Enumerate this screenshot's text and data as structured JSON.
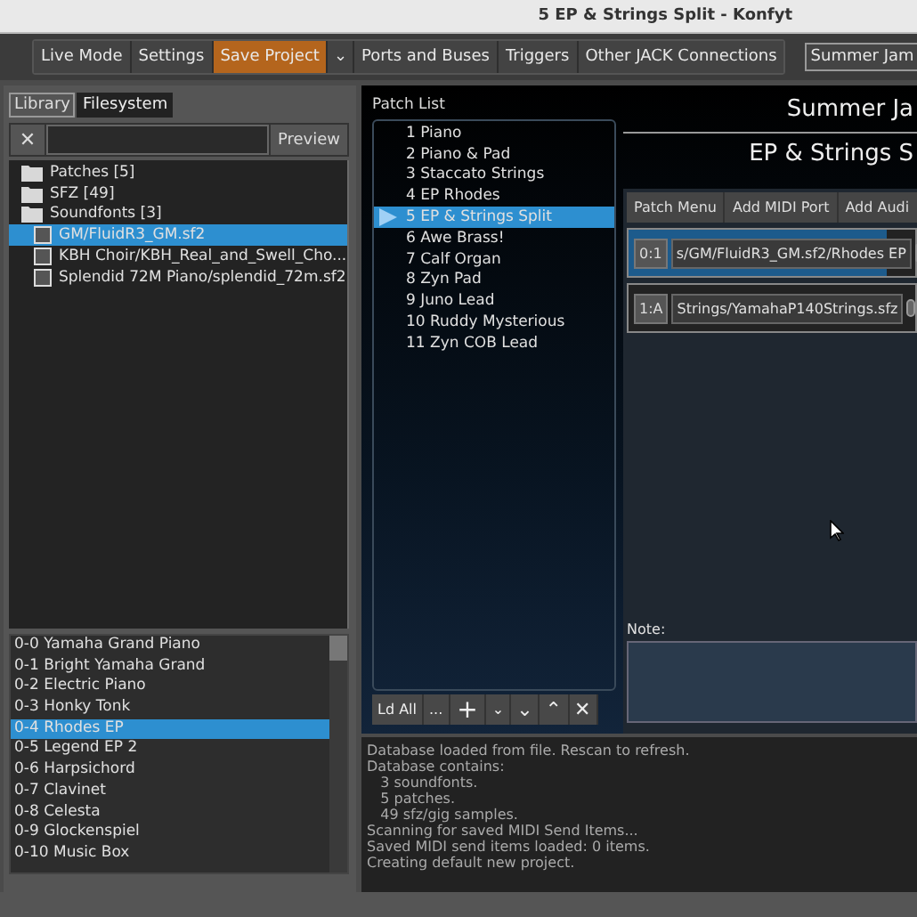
{
  "window": {
    "title": "5 EP & Strings Split - Konfyt"
  },
  "toolbar": {
    "buttons": [
      {
        "label": "Live Mode",
        "kind": "plain"
      },
      {
        "label": "Settings",
        "kind": "plain"
      },
      {
        "label": "Save Project",
        "kind": "accent"
      },
      {
        "label": "⌄",
        "kind": "menu"
      },
      {
        "label": "Ports and Buses",
        "kind": "plain"
      },
      {
        "label": "Triggers",
        "kind": "plain"
      },
      {
        "label": "Other JACK Connections",
        "kind": "plain"
      }
    ],
    "project": "Summer Jam"
  },
  "library": {
    "tabs": [
      {
        "label": "Library",
        "selected": true
      },
      {
        "label": "Filesystem",
        "selected": false
      }
    ],
    "clear_button": "✕",
    "preview_button": "Preview",
    "tree": [
      {
        "label": "Patches [5]",
        "kind": "folder",
        "selected": false
      },
      {
        "label": "SFZ [49]",
        "kind": "folder",
        "selected": false
      },
      {
        "label": "Soundfonts [3]",
        "kind": "folder",
        "selected": false,
        "children": [
          {
            "label": "GM/FluidR3_GM.sf2",
            "kind": "file",
            "selected": true
          },
          {
            "label": "KBH Choir/KBH_Real_and_Swell_Cho...",
            "kind": "file",
            "selected": false
          },
          {
            "label": "Splendid 72M Piano/splendid_72m.sf2",
            "kind": "file",
            "selected": false
          }
        ]
      }
    ],
    "presets": [
      {
        "label": "0-0 Yamaha Grand Piano",
        "selected": false
      },
      {
        "label": "0-1 Bright Yamaha Grand",
        "selected": false
      },
      {
        "label": "0-2 Electric Piano",
        "selected": false
      },
      {
        "label": "0-3 Honky Tonk",
        "selected": false
      },
      {
        "label": "0-4 Rhodes EP",
        "selected": true
      },
      {
        "label": "0-5 Legend EP 2",
        "selected": false
      },
      {
        "label": "0-6 Harpsichord",
        "selected": false
      },
      {
        "label": "0-7 Clavinet",
        "selected": false
      },
      {
        "label": "0-8 Celesta",
        "selected": false
      },
      {
        "label": "0-9 Glockenspiel",
        "selected": false
      },
      {
        "label": "0-10 Music Box",
        "selected": false
      }
    ]
  },
  "patch_list": {
    "title": "Patch List",
    "patches": [
      {
        "label": "1 Piano",
        "selected": false
      },
      {
        "label": "2 Piano & Pad",
        "selected": false
      },
      {
        "label": "3 Staccato Strings",
        "selected": false
      },
      {
        "label": "4 EP Rhodes",
        "selected": false
      },
      {
        "label": "5 EP & Strings Split",
        "selected": true
      },
      {
        "label": "6 Awe Brass!",
        "selected": false
      },
      {
        "label": "7 Calf Organ",
        "selected": false
      },
      {
        "label": "8 Zyn Pad",
        "selected": false
      },
      {
        "label": "9 Juno Lead",
        "selected": false
      },
      {
        "label": "10 Ruddy Mysterious",
        "selected": false
      },
      {
        "label": "11 Zyn COB Lead",
        "selected": false
      }
    ],
    "buttons": [
      {
        "label": "Ld All",
        "kind": "text"
      },
      {
        "label": "...",
        "kind": "text"
      },
      {
        "label": "+",
        "kind": "add"
      },
      {
        "label": "⌄",
        "kind": "small"
      },
      {
        "label": "⌄",
        "kind": "down"
      },
      {
        "label": "⌃",
        "kind": "up"
      },
      {
        "label": "✕",
        "kind": "remove"
      }
    ]
  },
  "patch": {
    "project_title": "Summer Ja",
    "title": "EP & Strings S",
    "buttons": [
      "Patch Menu",
      "Add MIDI Port",
      "Add Audi"
    ],
    "layers": [
      {
        "port": "0:1",
        "path": "s/GM/FluidR3_GM.sf2/Rhodes EP",
        "selected": true
      },
      {
        "port": "1:A",
        "path": "Strings/YamahaP140Strings.sfz",
        "selected": false
      }
    ],
    "note_label": "Note:"
  },
  "log": [
    "Database loaded from file. Rescan to refresh.",
    "Database contains:",
    "   3 soundfonts.",
    "   5 patches.",
    "   49 sfz/gig samples.",
    "Scanning for saved MIDI Send Items...",
    "Saved MIDI send items loaded: 0 items.",
    "Creating default new project."
  ]
}
